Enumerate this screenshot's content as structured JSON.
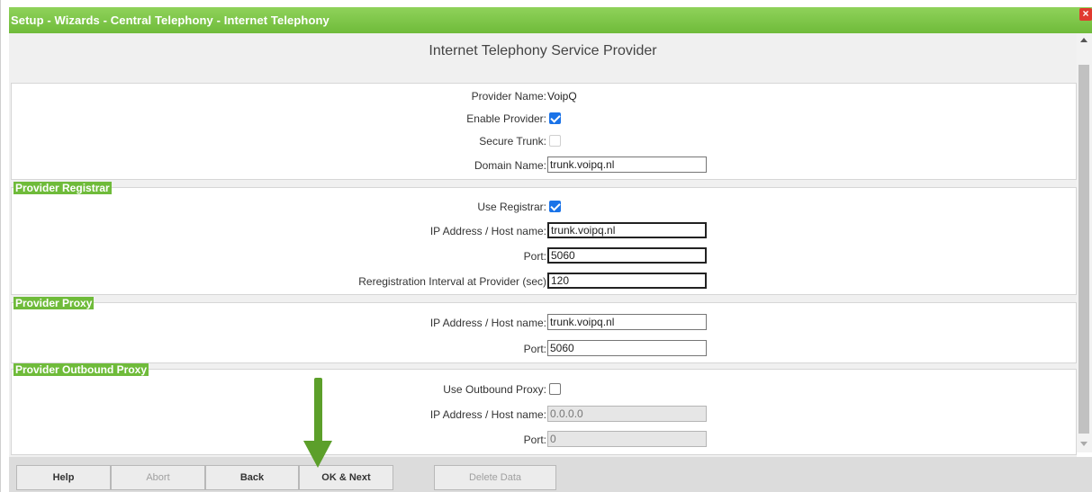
{
  "window": {
    "title": "Setup - Wizards - Central Telephony - Internet Telephony",
    "close_label": "×"
  },
  "heading": "Internet Telephony Service Provider",
  "provider": {
    "name_label": "Provider Name:",
    "name_value": "VoipQ",
    "enable_label": "Enable Provider:",
    "enable_checked": true,
    "secure_label": "Secure Trunk:",
    "secure_checked": false,
    "domain_label": "Domain Name:",
    "domain_value": "trunk.voipq.nl"
  },
  "registrar": {
    "legend": "Provider Registrar",
    "use_label": "Use Registrar:",
    "use_checked": true,
    "host_label": "IP Address / Host name:",
    "host_value": "trunk.voipq.nl",
    "port_label": "Port:",
    "port_value": "5060",
    "interval_label": "Reregistration Interval at Provider (sec)",
    "interval_value": "120"
  },
  "proxy": {
    "legend": "Provider Proxy",
    "host_label": "IP Address / Host name:",
    "host_value": "trunk.voipq.nl",
    "port_label": "Port:",
    "port_value": "5060"
  },
  "outbound": {
    "legend": "Provider Outbound Proxy",
    "use_label": "Use Outbound Proxy:",
    "use_checked": false,
    "host_label": "IP Address / Host name:",
    "host_value": "0.0.0.0",
    "port_label": "Port:",
    "port_value": "0"
  },
  "footer": {
    "help": "Help",
    "abort": "Abort",
    "back": "Back",
    "ok_next": "OK & Next",
    "delete_data": "Delete Data"
  },
  "colors": {
    "titlebar": "#6fbb3a",
    "legend": "#6fbb3a",
    "arrow": "#5c9f2a",
    "checkbox_checked": "#1a73e8",
    "close": "#e03a2f"
  },
  "icons": [
    "close-icon",
    "scroll-up-icon",
    "scroll-down-icon",
    "annotation-arrow-icon"
  ]
}
